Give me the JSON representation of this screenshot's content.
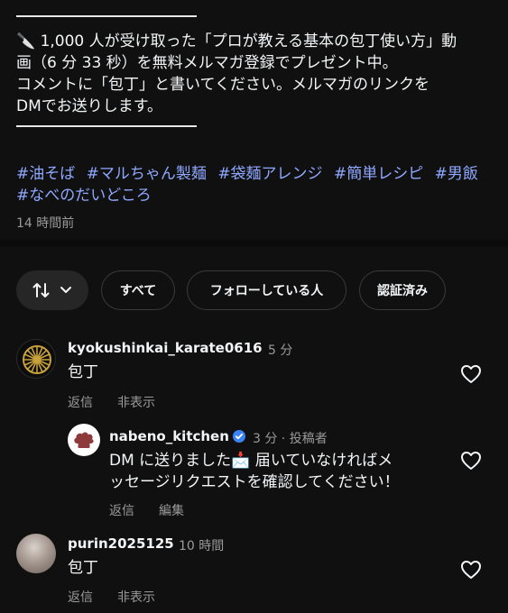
{
  "caption": {
    "line1": "🔪 1,000 人が受け取った「プロが教える基本の包丁使い方」動",
    "line2": "画（6 分 33 秒）を無料メルマガ登録でプレゼント中。",
    "line3": "コメントに「包丁」と書いてください。メルマガのリンクを",
    "line4": "DMでお送りします。",
    "hashtags_row1": [
      "#油そば",
      "#マルちゃん製麺",
      "#袋麺アレンジ",
      "#簡単レシピ",
      "#男飯"
    ],
    "hashtags_row2": [
      "#なべのだいどころ"
    ],
    "time_ago": "14 時間前"
  },
  "filters": {
    "sort_icon": "sort-arrows-icon",
    "chips": [
      "すべて",
      "フォローしている人",
      "認証済み"
    ]
  },
  "comments": [
    {
      "username": "kyokushinkai_karate0616",
      "time": "5 分",
      "text": "包丁",
      "actions": [
        "返信",
        "非表示"
      ]
    },
    {
      "username": "nabeno_kitchen",
      "time": "3 分 · 投稿者",
      "text_line1": "DM に送りました📩 届いていなければメ",
      "text_line2": "ッセージリクエストを確認してください！",
      "actions": [
        "返信",
        "編集"
      ]
    },
    {
      "username": "purin2025125",
      "time": "10 時間",
      "text": "包丁",
      "actions": [
        "返信",
        "非表示"
      ]
    }
  ],
  "colors": {
    "background": "#101010",
    "hashtag": "#8fa8ff",
    "muted": "#9a9a9a",
    "verified": "#3b82f6"
  }
}
